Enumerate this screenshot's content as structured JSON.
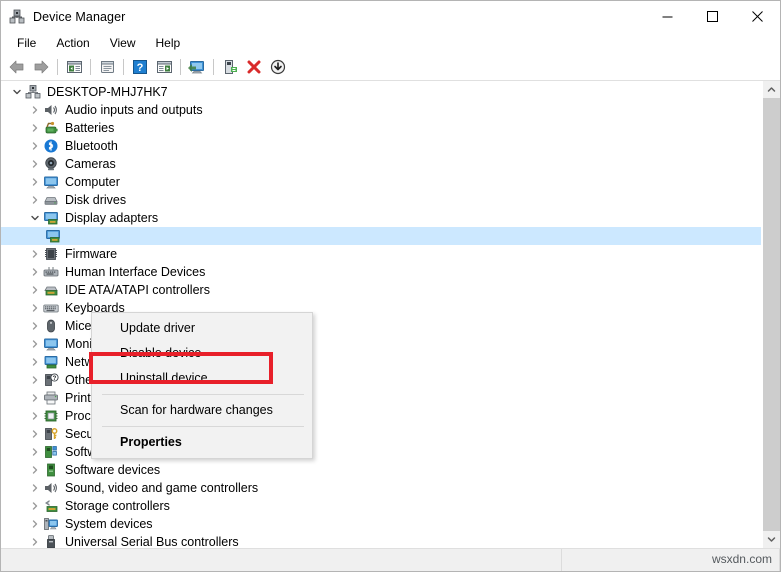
{
  "window": {
    "title": "Device Manager",
    "icon": "device-manager-icon",
    "controls": {
      "minimize": "minimize-button",
      "maximize": "maximize-button",
      "close": "close-button"
    }
  },
  "menubar": {
    "items": [
      {
        "label": "File"
      },
      {
        "label": "Action"
      },
      {
        "label": "View"
      },
      {
        "label": "Help"
      }
    ]
  },
  "toolbar": {
    "buttons": [
      {
        "name": "back-icon"
      },
      {
        "name": "forward-icon"
      },
      {
        "name": "separator"
      },
      {
        "name": "show-hide-console-tree-icon"
      },
      {
        "name": "separator"
      },
      {
        "name": "properties-icon"
      },
      {
        "name": "separator"
      },
      {
        "name": "help-icon"
      },
      {
        "name": "action-list-icon"
      },
      {
        "name": "separator"
      },
      {
        "name": "scan-for-hardware-changes-icon"
      },
      {
        "name": "separator"
      },
      {
        "name": "update-driver-icon"
      },
      {
        "name": "uninstall-device-icon"
      },
      {
        "name": "disable-device-icon"
      }
    ]
  },
  "tree": {
    "root": {
      "label": "DESKTOP-MHJ7HK7",
      "icon": "computer-root-icon",
      "expanded": true
    },
    "items": [
      {
        "label": "Audio inputs and outputs",
        "icon": "speaker-icon",
        "expanded": false
      },
      {
        "label": "Batteries",
        "icon": "battery-icon",
        "expanded": false
      },
      {
        "label": "Bluetooth",
        "icon": "bluetooth-icon",
        "expanded": false
      },
      {
        "label": "Cameras",
        "icon": "camera-icon",
        "expanded": false
      },
      {
        "label": "Computer",
        "icon": "monitor-icon",
        "expanded": false
      },
      {
        "label": "Disk drives",
        "icon": "disk-drive-icon",
        "expanded": false
      },
      {
        "label": "Display adapters",
        "icon": "display-adapter-icon",
        "expanded": true
      },
      {
        "label": "Firmware",
        "icon": "firmware-icon",
        "expanded": false
      },
      {
        "label": "Human Interface Devices",
        "icon": "hid-icon",
        "expanded": false
      },
      {
        "label": "IDE ATA/ATAPI controllers",
        "icon": "ide-controller-icon",
        "expanded": false
      },
      {
        "label": "Keyboards",
        "icon": "keyboard-icon",
        "expanded": false
      },
      {
        "label": "Mice and other pointing devices",
        "icon": "mouse-icon",
        "expanded": false
      },
      {
        "label": "Monitors",
        "icon": "monitor-icon",
        "expanded": false
      },
      {
        "label": "Network adapters",
        "icon": "network-adapter-icon",
        "expanded": false
      },
      {
        "label": "Other devices",
        "icon": "other-device-icon",
        "expanded": false
      },
      {
        "label": "Print queues",
        "icon": "printer-icon",
        "expanded": false
      },
      {
        "label": "Processors",
        "icon": "processor-icon",
        "expanded": false
      },
      {
        "label": "Security devices",
        "icon": "security-device-icon",
        "expanded": false
      },
      {
        "label": "Software components",
        "icon": "software-component-icon",
        "expanded": false
      },
      {
        "label": "Software devices",
        "icon": "software-device-icon",
        "expanded": false
      },
      {
        "label": "Sound, video and game controllers",
        "icon": "speaker-icon",
        "expanded": false
      },
      {
        "label": "Storage controllers",
        "icon": "storage-controller-icon",
        "expanded": false
      },
      {
        "label": "System devices",
        "icon": "system-device-icon",
        "expanded": false
      },
      {
        "label": "Universal Serial Bus controllers",
        "icon": "usb-controller-icon",
        "expanded": false
      }
    ],
    "selected_child": {
      "label": "",
      "icon": "display-adapter-icon",
      "parent": "Display adapters"
    }
  },
  "context_menu": {
    "items": [
      {
        "label": "Update driver",
        "bold": false
      },
      {
        "label": "Disable device",
        "bold": false
      },
      {
        "label": "Uninstall device",
        "bold": false,
        "highlighted": true
      },
      {
        "label": "Scan for hardware changes",
        "bold": false
      },
      {
        "label": "Properties",
        "bold": true
      }
    ]
  },
  "annotation": {
    "highlight_color": "#e8202a",
    "target": "Uninstall device"
  },
  "statusbar": {
    "watermark": "wsxdn.com"
  }
}
